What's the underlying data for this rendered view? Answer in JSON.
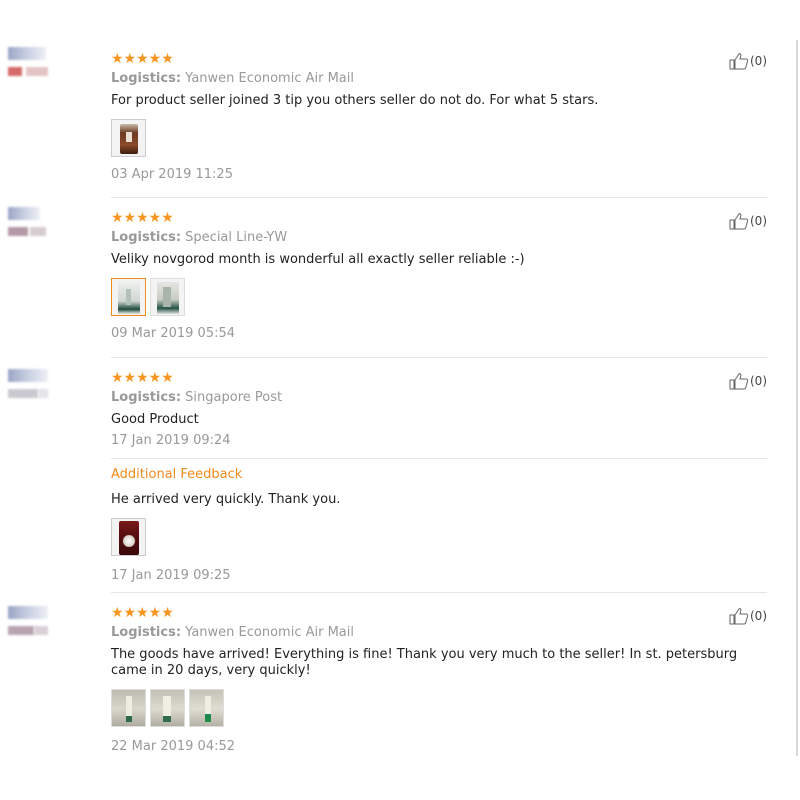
{
  "reviews": [
    {
      "stars": "★★★★★",
      "logistics_label": "Logistics:",
      "logistics": "Yanwen Economic Air Mail",
      "comment": "For product seller joined 3 tip you others seller do not do. For what 5 stars.",
      "date": "03 Apr 2019 11:25",
      "likes": "(0)"
    },
    {
      "stars": "★★★★★",
      "logistics_label": "Logistics:",
      "logistics": "Special Line-YW",
      "comment": "Veliky novgorod month is wonderful all exactly seller reliable :-)",
      "date": "09 Mar 2019 05:54",
      "likes": "(0)"
    },
    {
      "stars": "★★★★★",
      "logistics_label": "Logistics:",
      "logistics": "Singapore Post",
      "comment": "Good Product",
      "date": "17 Jan 2019 09:24",
      "additional_title": "Additional Feedback",
      "additional_comment": "He arrived very quickly. Thank you.",
      "additional_date": "17 Jan 2019 09:25",
      "likes": "(0)"
    },
    {
      "stars": "★★★★★",
      "logistics_label": "Logistics:",
      "logistics": "Yanwen Economic Air Mail",
      "comment": "The goods have arrived! Everything is fine! Thank you very much to the seller! In st. petersburg came in 20 days, very quickly!",
      "date": "22 Mar 2019 04:52",
      "likes": "(0)"
    }
  ],
  "icons": {
    "star": "star-icon",
    "like": "thumbs-up-icon"
  },
  "colors": {
    "star": "#f79520",
    "accent": "#f08a1e",
    "muted": "#999999"
  }
}
